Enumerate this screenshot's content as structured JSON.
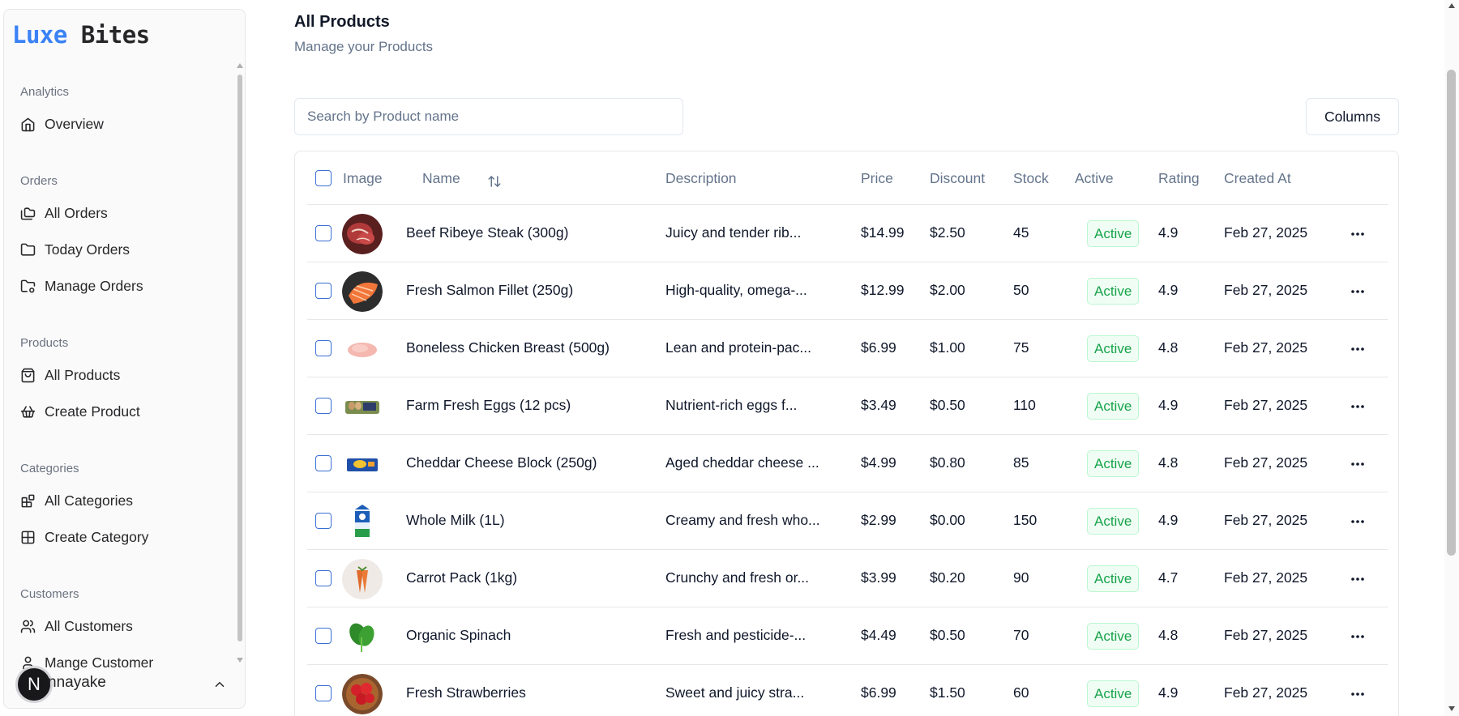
{
  "brand": {
    "name_colored": "Luxe",
    "name_rest": "Bites",
    "accent": "#3b82f6"
  },
  "sidebar": {
    "groups": [
      {
        "label": "Analytics",
        "items": [
          {
            "label": "Overview",
            "icon": "home-icon"
          }
        ]
      },
      {
        "label": "Orders",
        "items": [
          {
            "label": "All Orders",
            "icon": "folders-icon"
          },
          {
            "label": "Today Orders",
            "icon": "folder-icon"
          },
          {
            "label": "Manage Orders",
            "icon": "folder-cog-icon"
          }
        ]
      },
      {
        "label": "Products",
        "items": [
          {
            "label": "All Products",
            "icon": "shopping-bag-icon"
          },
          {
            "label": "Create Product",
            "icon": "basket-icon"
          }
        ]
      },
      {
        "label": "Categories",
        "items": [
          {
            "label": "All Categories",
            "icon": "blocks-icon"
          },
          {
            "label": "Create Category",
            "icon": "grid-icon"
          }
        ]
      },
      {
        "label": "Customers",
        "items": [
          {
            "label": "All Customers",
            "icon": "users-icon"
          },
          {
            "label": "Mange Customer",
            "icon": "user-icon"
          }
        ]
      }
    ],
    "user": {
      "avatar_letter": "N",
      "name": "nnayake"
    }
  },
  "page": {
    "title": "All Products",
    "subtitle": "Manage your Products"
  },
  "search": {
    "placeholder": "Search by Product name",
    "value": ""
  },
  "toolbar": {
    "columns_label": "Columns"
  },
  "table": {
    "headers": {
      "image": "Image",
      "name": "Name",
      "description": "Description",
      "price": "Price",
      "discount": "Discount",
      "stock": "Stock",
      "active": "Active",
      "rating": "Rating",
      "created_at": "Created At"
    },
    "status_color": "#16a34a",
    "rows": [
      {
        "name": "Beef Ribeye Steak (300g)",
        "description": "Juicy and tender rib...",
        "price": "$14.99",
        "discount": "$2.50",
        "stock": "45",
        "status": "Active",
        "rating": "4.9",
        "created_at": "Feb 27, 2025",
        "image": "steak-image"
      },
      {
        "name": "Fresh Salmon Fillet (250g)",
        "description": "High-quality, omega-...",
        "price": "$12.99",
        "discount": "$2.00",
        "stock": "50",
        "status": "Active",
        "rating": "4.9",
        "created_at": "Feb 27, 2025",
        "image": "salmon-image"
      },
      {
        "name": "Boneless Chicken Breast (500g)",
        "description": "Lean and protein-pac...",
        "price": "$6.99",
        "discount": "$1.00",
        "stock": "75",
        "status": "Active",
        "rating": "4.8",
        "created_at": "Feb 27, 2025",
        "image": "chicken-image"
      },
      {
        "name": "Farm Fresh Eggs (12 pcs)",
        "description": "Nutrient-rich eggs f...",
        "price": "$3.49",
        "discount": "$0.50",
        "stock": "110",
        "status": "Active",
        "rating": "4.9",
        "created_at": "Feb 27, 2025",
        "image": "eggs-image"
      },
      {
        "name": "Cheddar Cheese Block (250g)",
        "description": "Aged cheddar cheese ...",
        "price": "$4.99",
        "discount": "$0.80",
        "stock": "85",
        "status": "Active",
        "rating": "4.8",
        "created_at": "Feb 27, 2025",
        "image": "cheese-image"
      },
      {
        "name": "Whole Milk (1L)",
        "description": "Creamy and fresh who...",
        "price": "$2.99",
        "discount": "$0.00",
        "stock": "150",
        "status": "Active",
        "rating": "4.9",
        "created_at": "Feb 27, 2025",
        "image": "milk-image"
      },
      {
        "name": "Carrot Pack (1kg)",
        "description": "Crunchy and fresh or...",
        "price": "$3.99",
        "discount": "$0.20",
        "stock": "90",
        "status": "Active",
        "rating": "4.7",
        "created_at": "Feb 27, 2025",
        "image": "carrot-image"
      },
      {
        "name": "Organic Spinach",
        "description": "Fresh and pesticide-...",
        "price": "$4.49",
        "discount": "$0.50",
        "stock": "70",
        "status": "Active",
        "rating": "4.8",
        "created_at": "Feb 27, 2025",
        "image": "spinach-image"
      },
      {
        "name": "Fresh Strawberries",
        "description": "Sweet and juicy stra...",
        "price": "$6.99",
        "discount": "$1.50",
        "stock": "60",
        "status": "Active",
        "rating": "4.9",
        "created_at": "Feb 27, 2025",
        "image": "strawberries-image"
      }
    ]
  }
}
